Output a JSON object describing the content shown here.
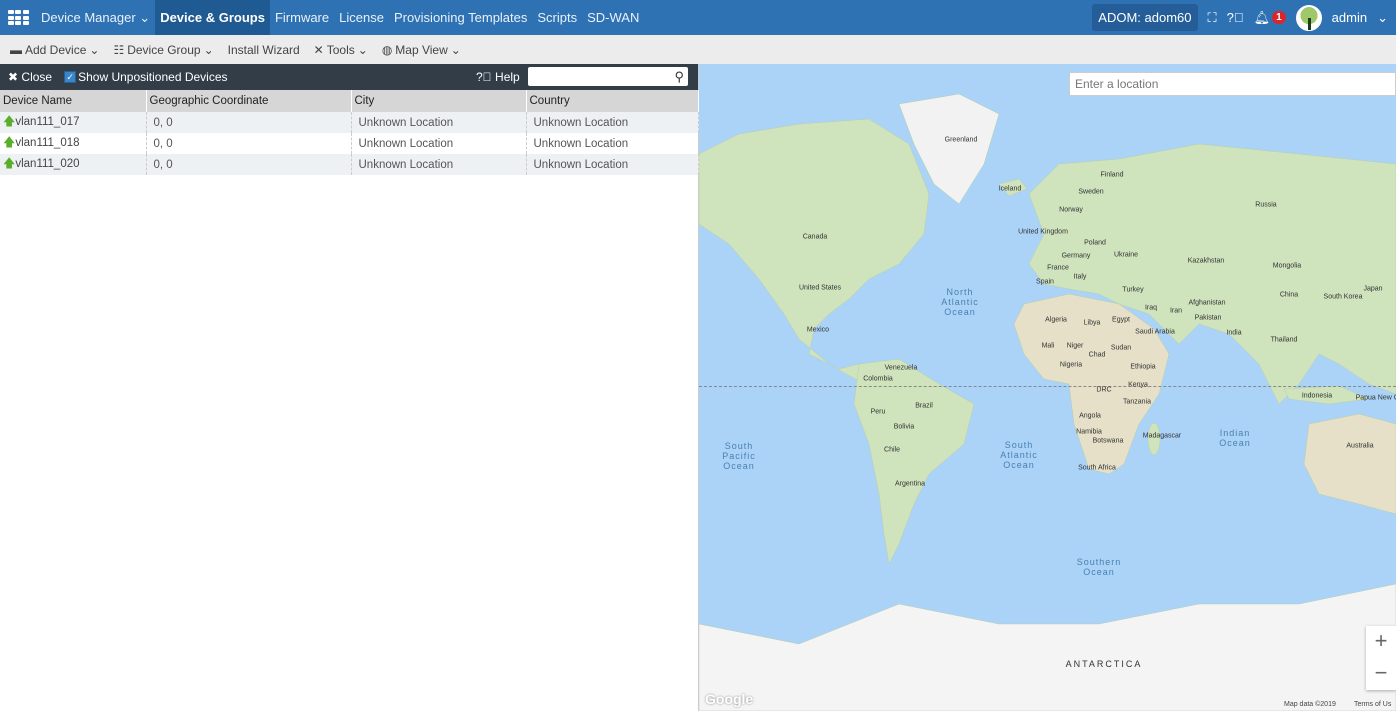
{
  "topbar": {
    "app_menu": "Device Manager",
    "nav": [
      "Device & Groups",
      "Firmware",
      "License",
      "Provisioning Templates",
      "Scripts",
      "SD-WAN"
    ],
    "adom": "ADOM: adom60",
    "notif_count": "1",
    "user": "admin"
  },
  "toolbar": {
    "add_device": "Add Device",
    "device_group": "Device Group",
    "install_wizard": "Install Wizard",
    "tools": "Tools",
    "map_view": "Map View"
  },
  "panel": {
    "close": "Close",
    "show_unpositioned": "Show Unpositioned Devices",
    "help": "Help",
    "search_value": "",
    "columns": [
      "Device Name",
      "Geographic Coordinate",
      "City",
      "Country"
    ],
    "rows": [
      [
        "vlan111_017",
        "0, 0",
        "Unknown Location",
        "Unknown Location"
      ],
      [
        "vlan111_018",
        "0, 0",
        "Unknown Location",
        "Unknown Location"
      ],
      [
        "vlan111_020",
        "0, 0",
        "Unknown Location",
        "Unknown Location"
      ]
    ]
  },
  "map": {
    "location_placeholder": "Enter a location",
    "logo": "Google",
    "map_data": "Map data ©2019",
    "terms": "Terms of Us",
    "labels": [
      "Greenland",
      "Iceland",
      "Finland",
      "Sweden",
      "Norway",
      "Russia",
      "United Kingdom",
      "Poland",
      "Canada",
      "Germany",
      "Ukraine",
      "Kazakhstan",
      "Mongolia",
      "France",
      "Italy",
      "Spain",
      "United States",
      "Turkey",
      "China",
      "South Korea",
      "Japan",
      "Iraq",
      "Afghanistan",
      "Iran",
      "Pakistan",
      "Algeria",
      "Libya",
      "Egypt",
      "Saudi Arabia",
      "India",
      "Mexico",
      "Mali",
      "Niger",
      "Chad",
      "Sudan",
      "Thailand",
      "Venezuela",
      "Colombia",
      "Nigeria",
      "Ethiopia",
      "Kenya",
      "DRC",
      "Indonesia",
      "Peru",
      "Brazil",
      "Tanzania",
      "Papua New Guine",
      "Angola",
      "Bolivia",
      "Namibia",
      "Botswana",
      "Madagascar",
      "Chile",
      "Australia",
      "South Africa",
      "Argentina",
      "ANTARCTICA"
    ],
    "oceans": [
      "North Atlantic Ocean",
      "South Pacific Ocean",
      "South Atlantic Ocean",
      "Indian Ocean",
      "Southern Ocean"
    ]
  }
}
